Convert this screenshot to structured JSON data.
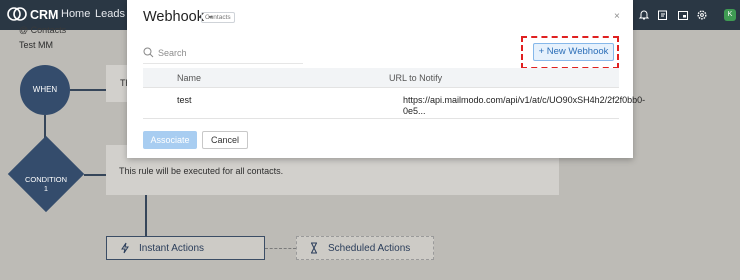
{
  "topbar": {
    "app_title": "CRM",
    "nav_home": "Home",
    "nav_leads": "Leads",
    "avatar_letter": "K",
    "icons": [
      "bell-icon",
      "compose-icon",
      "calendar-icon",
      "gear-icon"
    ]
  },
  "canvas": {
    "breadcrumb": "@ Contacts",
    "rule_name": "Test MM",
    "when_label": "WHEN",
    "condition_label": "CONDITION",
    "condition_number": "1",
    "panel1_text": "Th",
    "panel2_text": "This rule will be executed for all contacts.",
    "instant_actions": "Instant Actions",
    "scheduled_actions": "Scheduled Actions"
  },
  "modal": {
    "title": "Webhook -",
    "module_tag": "Contacts",
    "close": "×",
    "search_placeholder": "Search",
    "new_webhook": "+ New Webhook",
    "columns": [
      "Name",
      "URL to Notify"
    ],
    "rows": [
      {
        "name": "test",
        "url": "https://api.mailmodo.com/api/v1/at/c/UO90xSH4h2/2f2f0bb0-0e5..."
      }
    ],
    "associate": "Associate",
    "cancel": "Cancel"
  },
  "colors": {
    "topbar": "#2a3744",
    "node": "#344c6c",
    "accent": "#2c6fb8",
    "highlight": "#e02020"
  }
}
